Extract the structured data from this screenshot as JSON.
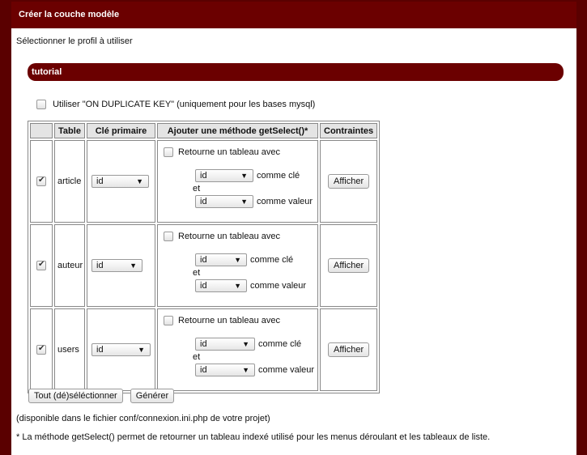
{
  "window": {
    "title": "Créer la couche modèle"
  },
  "subtitle": "Sélectionner le profil à utiliser",
  "profile": "tutorial",
  "duplicate_option": {
    "label": "Utiliser \"ON DUPLICATE KEY\" (uniquement pour les bases mysql)",
    "checked": false
  },
  "table": {
    "headers": [
      "",
      "Table",
      "Clé primaire",
      "Ajouter une méthode getSelect()*",
      "Contraintes"
    ],
    "rows": [
      {
        "checked": true,
        "table": "article",
        "key": "id",
        "getselect_label": "Retourne un tableau avec",
        "key_select": "id",
        "key_label": "comme clé",
        "and_label": "et",
        "value_select": "id",
        "value_label": "comme valeur",
        "constraint_button": "Afficher"
      },
      {
        "checked": true,
        "table": "auteur",
        "key": "id",
        "getselect_label": "Retourne un tableau avec",
        "key_select": "id",
        "key_label": "comme clé",
        "and_label": "et",
        "value_select": "id",
        "value_label": "comme valeur",
        "constraint_button": "Afficher"
      },
      {
        "checked": true,
        "table": "users",
        "key": "id",
        "getselect_label": "Retourne un tableau avec",
        "key_select": "id",
        "key_label": "comme clé",
        "and_label": "et",
        "value_select": "id",
        "value_label": "comme valeur",
        "constraint_button": "Afficher"
      }
    ]
  },
  "buttons": {
    "toggle_all": "Tout (dé)séléctionner",
    "generate": "Générer"
  },
  "notes": {
    "availability": "(disponible dans le fichier conf/connexion.ini.php de votre projet)",
    "getselect": "* La méthode getSelect() permet de retourner un tableau indexé utilisé pour les menus déroulant et les tableaux de liste."
  },
  "colors": {
    "brand": "#6b0000",
    "background": "#5a0000"
  }
}
